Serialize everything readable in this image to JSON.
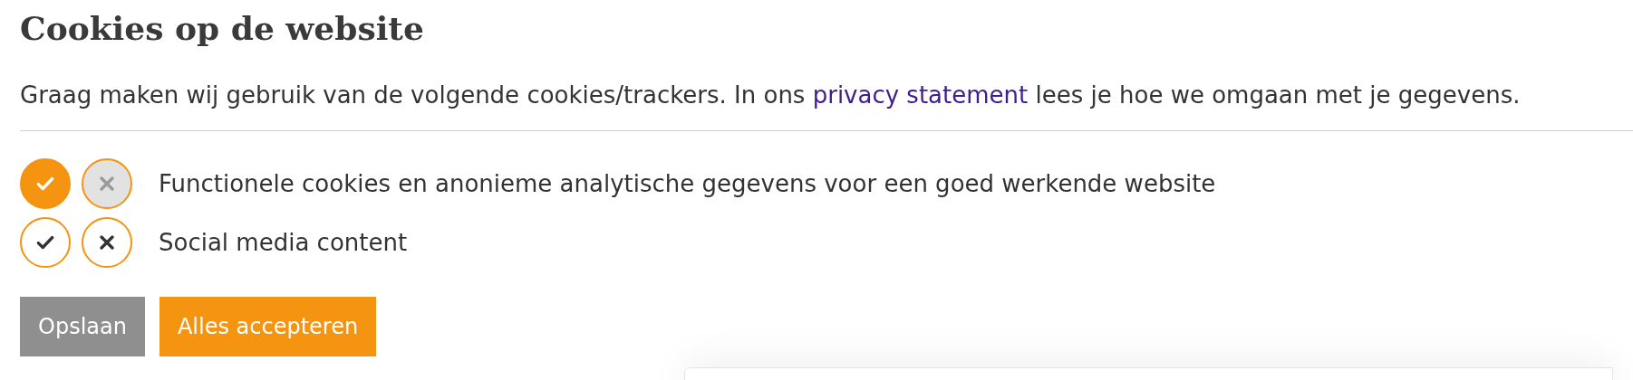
{
  "title": "Cookies op de website",
  "intro": {
    "before": "Graag maken wij gebruik van de volgende cookies/trackers. In ons ",
    "link": "privacy statement",
    "after": " lees je hoe we omgaan met je gegevens."
  },
  "cookies": [
    {
      "label": "Functionele cookies en anonieme analytische gegevens voor een goed werkende website",
      "accepted": true
    },
    {
      "label": "Social media content",
      "accepted": false
    }
  ],
  "buttons": [
    {
      "label": "Opslaan",
      "kind": "secondary"
    },
    {
      "label": "Alles accepteren",
      "kind": "primary"
    }
  ]
}
